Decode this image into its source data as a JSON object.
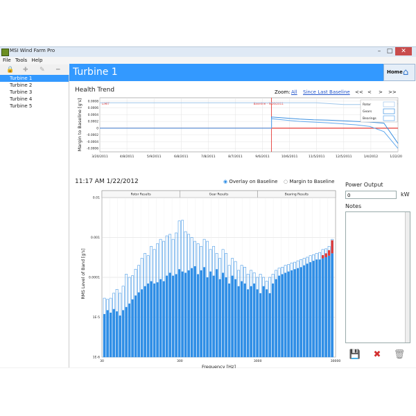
{
  "app": {
    "title": "MSI Wind Farm Pro"
  },
  "menu": [
    "File",
    "Tools",
    "Help"
  ],
  "sidebar": {
    "items": [
      "Turbine 1",
      "Turbine 2",
      "Turbine 3",
      "Turbine 4",
      "Turbine 5"
    ],
    "selected_index": 0
  },
  "header": {
    "title": "Turbine 1",
    "home_label": "Home"
  },
  "health": {
    "title": "Health Trend",
    "zoom_label": "Zoom:",
    "zoom_all": "All",
    "zoom_since": "Since Last Baseline",
    "nav": [
      "<<",
      "<",
      ">",
      ">>"
    ]
  },
  "spectrum": {
    "timestamp": "11:17 AM 1/22/2012",
    "overlay_label": "Overlay on Baseline",
    "margin_label": "Margin to Baseline"
  },
  "power": {
    "label": "Power Output",
    "value": "0",
    "unit": "kW"
  },
  "notes": {
    "label": "Notes"
  },
  "colors": {
    "accent": "#3399ff",
    "bar": "#2f8ee6",
    "bar_outline": "#4a9be6",
    "alarm": "#e53935"
  },
  "icons": [
    "lock-icon",
    "add-icon",
    "edit-icon",
    "remove-icon",
    "home-icon",
    "save-icon",
    "delete-icon",
    "trash-icon"
  ],
  "chart_data": [
    {
      "type": "line",
      "title": "Health Trend",
      "ylabel": "Margin to Baseline [g's]",
      "x_ticks": [
        "3/20/2011",
        "4/8/2011",
        "5/9/2011",
        "6/8/2011",
        "7/8/2011",
        "8/7/2011",
        "9/6/2011",
        "10/6/2011",
        "11/5/2011",
        "12/5/2011",
        "1/4/2012",
        "1/22/2012"
      ],
      "y_ticks": [
        "0.0008",
        "0.0006",
        "0.0004",
        "0.0002",
        "0",
        "-0.0002",
        "-0.0004",
        "-0.0006"
      ],
      "ylim": [
        -0.0007,
        0.0009
      ],
      "annotations": [
        "LIMIT",
        "Baseline - 9/16/2011"
      ],
      "limit_value": 0,
      "baseline_date": "9/16/2011",
      "legend": [
        "Rotor",
        "Gears",
        "Bearings"
      ],
      "series": [
        {
          "name": "Rotor",
          "values": [
            0.00075,
            0.00075,
            0.00075,
            0.00075,
            0.00075,
            0.00075,
            0.00075,
            0.00075,
            0.00075,
            0.0007,
            0.0007,
            0.00072
          ]
        },
        {
          "name": "Gears",
          "values": [
            0.0,
            0.0,
            0.0,
            0.0,
            0.0,
            0.0,
            0.0,
            0.0,
            0.00033,
            0.0003,
            0.00027,
            0.00025,
            0.00024,
            0.00022,
            0.0002,
            0.00018,
            0.00015,
            -0.00045
          ]
        },
        {
          "name": "Bearings",
          "values": [
            0.0,
            0.0,
            0.0,
            0.0,
            0.0,
            0.0,
            0.0,
            0.0,
            0.00028,
            0.00024,
            0.0002,
            0.00018,
            0.00016,
            0.00013,
            0.0001,
            5e-05,
            -0.0001,
            -0.0006
          ]
        }
      ]
    },
    {
      "type": "bar",
      "xlabel": "Frequency [Hz]",
      "ylabel": "RMS Level of Band [g's]",
      "x_ticks": [
        "30",
        "300",
        "3000",
        "30000"
      ],
      "y_ticks": [
        "0.01",
        "0.001",
        "0.0001",
        "1E-5",
        "1E-6"
      ],
      "yscale": "log",
      "ylim": [
        1e-06,
        0.01
      ],
      "sections": [
        "Rotor Results",
        "Gear Results",
        "Bearing Results"
      ],
      "values": [
        1.2e-05,
        1.5e-05,
        1.3e-05,
        1.6e-05,
        1.4e-05,
        1.1e-05,
        1.5e-05,
        1.8e-05,
        2.2e-05,
        2.8e-05,
        3.5e-05,
        4.2e-05,
        5e-05,
        6e-05,
        7e-05,
        8e-05,
        7e-05,
        7.5e-05,
        9e-05,
        8e-05,
        0.00011,
        0.00013,
        0.00011,
        0.00012,
        0.00016,
        0.00014,
        0.00013,
        0.00015,
        0.00017,
        0.00019,
        0.00012,
        0.00015,
        0.00018,
        0.0001,
        0.00014,
        0.00011,
        0.00016,
        9e-05,
        0.00013,
        0.0001,
        7e-05,
        0.00011,
        9e-05,
        6e-05,
        8e-05,
        7e-05,
        5e-05,
        6e-05,
        7e-05,
        5e-05,
        4e-05,
        6e-05,
        5e-05,
        4e-05,
        7e-05,
        9e-05,
        0.00011,
        0.00012,
        0.00013,
        0.00014,
        0.00015,
        0.00016,
        0.00017,
        0.00018,
        0.0002,
        0.00022,
        0.00024,
        0.00026,
        0.00028,
        0.00028,
        0.0003,
        0.00032,
        0.00035,
        0.0004
      ],
      "baseline": [
        3e-05,
        2.8e-05,
        3e-05,
        4e-05,
        5e-05,
        4e-05,
        6e-05,
        0.00012,
        0.0001,
        0.00011,
        0.00016,
        0.0002,
        0.0003,
        0.0004,
        0.00035,
        0.0006,
        0.0005,
        0.0007,
        0.0009,
        0.0008,
        0.0011,
        0.0012,
        0.0009,
        0.0013,
        0.0026,
        0.0027,
        0.0014,
        0.0012,
        0.001,
        0.0008,
        0.0007,
        0.0006,
        0.0009,
        0.0008,
        0.0005,
        0.0006,
        0.0004,
        0.0003,
        0.0005,
        0.0004,
        0.0002,
        0.0003,
        0.00025,
        0.00015,
        0.0002,
        0.00018,
        0.00012,
        0.00015,
        0.00013,
        0.0001,
        0.00012,
        0.0001,
        8e-05,
        0.0001,
        0.00012,
        0.00015,
        0.00017,
        0.00018,
        0.0002,
        0.00021,
        0.00023,
        0.00024,
        0.00026,
        0.00028,
        0.0003,
        0.00032,
        0.00035,
        0.00037,
        0.0004,
        0.00042,
        0.0005,
        0.00052,
        0.0006,
        0.0009
      ],
      "exceed": [
        0,
        0,
        0,
        0,
        0,
        0,
        0,
        0,
        0,
        0,
        0,
        0,
        0,
        0,
        0,
        0,
        0,
        0,
        0,
        0,
        0,
        0,
        0,
        0,
        0,
        0,
        0,
        0,
        0,
        0,
        0,
        0,
        0,
        0,
        0,
        0,
        0,
        0,
        0,
        0,
        0,
        0,
        0,
        0,
        0,
        0,
        0,
        0,
        0,
        0,
        0,
        0,
        0,
        0,
        0,
        0,
        0,
        0,
        0,
        0,
        0,
        0,
        0,
        0,
        0,
        0,
        0,
        0,
        0,
        0,
        0.00036,
        0.0004,
        0.00048,
        0.00085
      ]
    }
  ]
}
